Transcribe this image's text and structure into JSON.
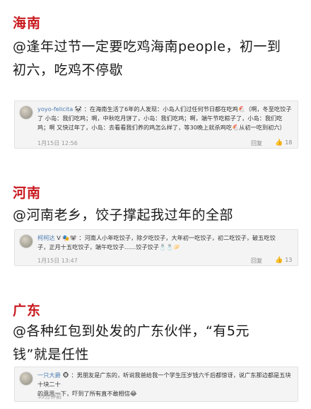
{
  "sections": [
    {
      "region": "海南",
      "caption_line1": "@逢年过节一定要吃鸡海南people，初一到",
      "caption_line2": "初六，吃鸡不停歇",
      "comment": {
        "username": "yoyo-felicita",
        "user_badges": "🐼",
        "line1": "：在海南生活了6年的人发现：小岛人们过任何节日都在吃鸡🐔（啊，冬至吃饺子",
        "line2": "了 小岛：我们吃鸡；啊，中秋吃月饼了，小岛：我们吃鸡；啊，端午节吃粽子了，小岛：我们吃",
        "line3": "鸡；啊 又快过年了，小岛：去看看我们养的鸡怎么样了，等30晚上就杀鸡吃🐔从初一吃到初六）",
        "date": "1月15日 12:56",
        "reply_label": "回复",
        "likes": "18"
      }
    },
    {
      "region": "河南",
      "caption_line1": "@河南老乡，饺子撑起我过年的全部",
      "comment": {
        "username": "柯柯达",
        "user_badges": "V 🎭🐨",
        "line1": "：河南人小年吃饺子，除夕吃饺子，大年初一吃饺子，初二吃饺子，破五吃饺",
        "line2": "子，正月十五吃饺子，端午吃饺子……饺子饺子🧂🧂🥟",
        "date": "1月15日 13:47",
        "reply_label": "回复",
        "likes": "13"
      }
    },
    {
      "region": "广东",
      "caption_line1": "@各种红包到处发的广东伙伴，“有5元",
      "caption_line2": "钱”就是任性",
      "comment": {
        "username": "一只大爵",
        "user_badges": "🐵",
        "line1": "：男朋友是广东的，听说我爸给我一个学生压岁钱六千后都惊讶，说广东那边都是五块十块二十",
        "line2": "的意思一下，吓到了所有直不敢相信😂",
        "date": "35分钟前"
      }
    }
  ],
  "icons": {
    "like": "thumbs-up-icon"
  }
}
